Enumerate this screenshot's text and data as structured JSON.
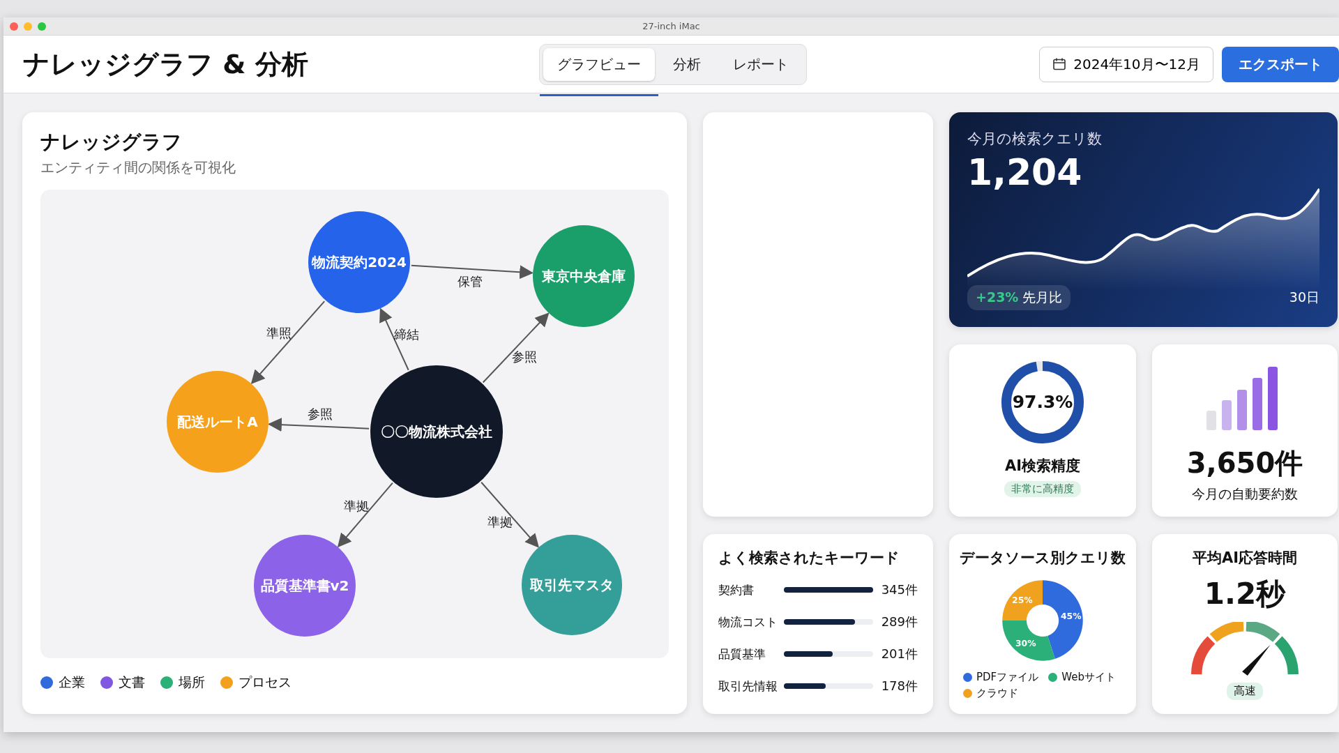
{
  "window": {
    "title": "27-inch iMac"
  },
  "app_title": "ナレッジグラフ & 分析",
  "tabs": [
    {
      "label": "グラフビュー",
      "selected": true
    },
    {
      "label": "分析",
      "selected": false
    },
    {
      "label": "レポート",
      "selected": false
    }
  ],
  "date_range": "2024年10月〜12月",
  "export_button": "エクスポート",
  "graph_card": {
    "title": "ナレッジグラフ",
    "subtitle": "エンティティ間の関係を可視化",
    "nodes": [
      {
        "label": "物流契約2024",
        "color": "#2563eb"
      },
      {
        "label": "東京中央倉庫",
        "color": "#1a9e6a"
      },
      {
        "label": "配送ルートA",
        "color": "#f5a11c"
      },
      {
        "label": "〇〇物流株式会社",
        "color": "#111827"
      },
      {
        "label": "品質基準書v2",
        "color": "#8b62e8"
      },
      {
        "label": "取引先マスタ",
        "color": "#349e98"
      }
    ],
    "edges": [
      {
        "label": "保管"
      },
      {
        "label": "準照"
      },
      {
        "label": "締結"
      },
      {
        "label": "参照"
      },
      {
        "label": "参照"
      },
      {
        "label": "準拠"
      },
      {
        "label": "準拠"
      }
    ],
    "legend": [
      {
        "label": "企業",
        "color": "#2f6bdc"
      },
      {
        "label": "文書",
        "color": "#8058e0"
      },
      {
        "label": "場所",
        "color": "#2bb07a"
      },
      {
        "label": "プロセス",
        "color": "#f2a11e"
      }
    ]
  },
  "query_card": {
    "label": "今月の検索クエリ数",
    "value": "1,204",
    "change": "+23%",
    "change_label": "先月比",
    "period": "30日"
  },
  "accuracy_card": {
    "value": "97.3%",
    "level": 0.973,
    "label": "AI検索精度",
    "badge": "非常に高精度"
  },
  "summary_card": {
    "value": "3,650件",
    "label": "今月の自動要約数"
  },
  "keywords_card": {
    "title": "よく検索されたキーワード",
    "rows": [
      {
        "label": "契約書",
        "level": 1.0,
        "count": "345件"
      },
      {
        "label": "物流コスト",
        "level": 0.8,
        "count": "289件"
      },
      {
        "label": "品質基準",
        "level": 0.55,
        "count": "201件"
      },
      {
        "label": "取引先情報",
        "level": 0.47,
        "count": "178件"
      }
    ]
  },
  "sources_card": {
    "chart_data": {
      "type": "donut",
      "title": "データソース別クエリ数",
      "categories": [
        "PDFファイル",
        "Webサイト",
        "クラウド"
      ],
      "values": [
        45,
        30,
        25
      ],
      "value_labels": [
        "45%",
        "30%",
        "25%"
      ]
    },
    "legend": [
      {
        "color": "#2f6bdc"
      },
      {
        "color": "#2bb07a"
      },
      {
        "color": "#f0a21f"
      }
    ]
  },
  "response_card": {
    "title": "平均AI応答時間",
    "value": "1.2秒",
    "badge": "高速"
  }
}
